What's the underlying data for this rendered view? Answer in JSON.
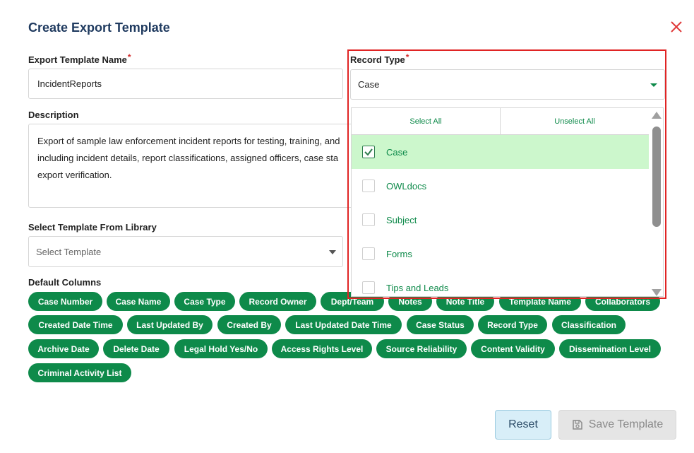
{
  "dialog": {
    "title": "Create Export Template"
  },
  "form": {
    "name_label": "Export Template Name",
    "name_required": "*",
    "name_value": "IncidentReports",
    "description_label": "Description",
    "description_value": "Export of sample law enforcement incident reports for testing, training, and\nincluding incident details, report classifications, assigned officers, case sta\nexport verification.",
    "library_label": "Select Template From Library",
    "library_placeholder": "Select Template",
    "record_type_label": "Record Type",
    "record_type_required": "*",
    "record_type_value": "Case",
    "default_columns_label": "Default Columns"
  },
  "record_type_menu": {
    "select_all": "Select All",
    "unselect_all": "Unselect All",
    "options": [
      {
        "label": "Case",
        "checked": true
      },
      {
        "label": "OWLdocs",
        "checked": false
      },
      {
        "label": "Subject",
        "checked": false
      },
      {
        "label": "Forms",
        "checked": false
      },
      {
        "label": "Tips and Leads",
        "checked": false
      }
    ]
  },
  "columns": [
    "Case Number",
    "Case Name",
    "Case Type",
    "Record Owner",
    "Dept/Team",
    "Notes",
    "Note Title",
    "Template Name",
    "Collaborators",
    "Created Date Time",
    "Last Updated By",
    "Created By",
    "Last Updated Date Time",
    "Case Status",
    "Record Type",
    "Classification",
    "Archive Date",
    "Delete Date",
    "Legal Hold Yes/No",
    "Access Rights Level",
    "Source Reliability",
    "Content Validity",
    "Dissemination Level",
    "Criminal Activity List"
  ],
  "buttons": {
    "reset": "Reset",
    "save": "Save Template"
  },
  "colors": {
    "accent": "#0e8a4a",
    "title": "#1f3a5f",
    "highlight_border": "#e02424",
    "selected_row": "#ccf7cc"
  }
}
